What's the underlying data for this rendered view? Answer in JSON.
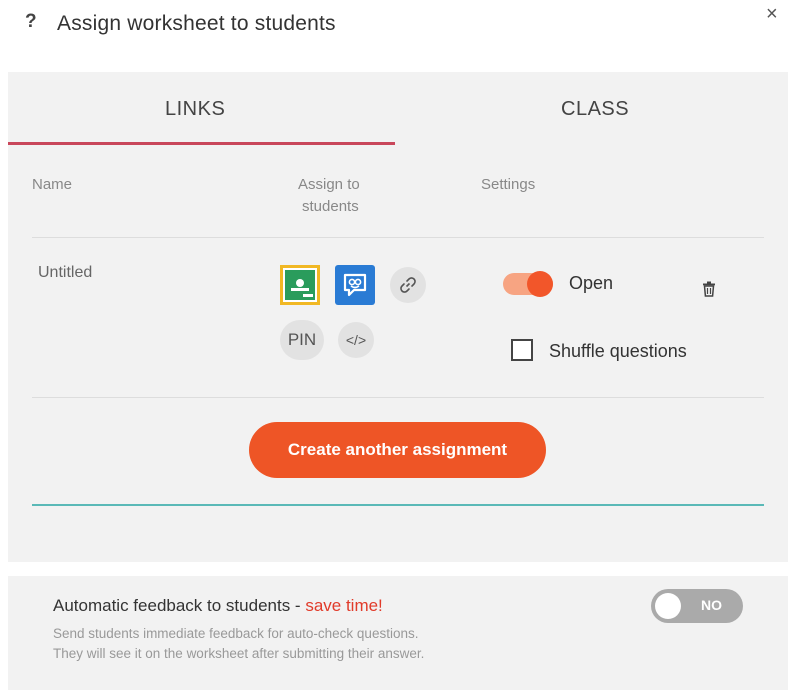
{
  "header": {
    "help_icon": "?",
    "title": "Assign worksheet to students",
    "close_icon": "×"
  },
  "tabs": [
    {
      "label": "LINKS",
      "active": true
    },
    {
      "label": "CLASS",
      "active": false
    }
  ],
  "table": {
    "columns": {
      "name": "Name",
      "assign_line1": "Assign to",
      "assign_line2": "students",
      "settings": "Settings"
    },
    "rows": [
      {
        "name": "Untitled",
        "assign_icons": [
          "google-classroom-icon",
          "edmodo-icon",
          "link-icon"
        ],
        "pin_label": "PIN",
        "embed_label": "</>",
        "status_label": "Open",
        "status_on": true,
        "shuffle_label": "Shuffle questions",
        "shuffle_checked": false
      }
    ]
  },
  "create_button": "Create another assignment",
  "feedback": {
    "title": "Automatic feedback to students - ",
    "title_accent": "save time!",
    "desc_line1": "Send students immediate feedback for auto-check questions.",
    "desc_line2": "They will see it on the worksheet after submitting their answer.",
    "toggle_label": "NO",
    "toggle_on": false
  },
  "colors": {
    "tab_underline": "#c9475b",
    "accent_orange": "#ee5526",
    "teal_line": "#5ab9b7",
    "classroom_green": "#2a9c5c",
    "classroom_border": "#f1b824",
    "edmodo_blue": "#2a7bd4",
    "save_time_red": "#e13b2a"
  }
}
